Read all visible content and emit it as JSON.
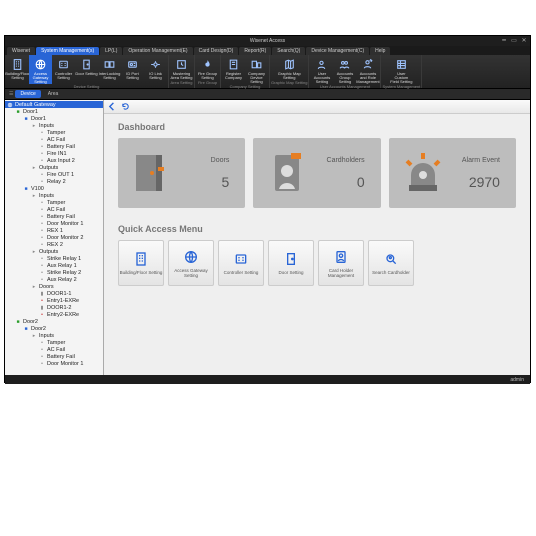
{
  "title": "Wisenet Access",
  "menu_tabs": [
    "Wisenet",
    "System Management(s)",
    "LP(L)",
    "Operation Management(E)",
    "Card Design(D)",
    "Report(R)",
    "Search(Q)",
    "Device Management(C)",
    "Help"
  ],
  "active_menu_tab": 1,
  "ribbon_groups": [
    {
      "label": "Device Setting",
      "items": [
        {
          "icon": "building",
          "label": "Building/Floor Setting"
        },
        {
          "icon": "globe",
          "label": "Access Gateway Setting",
          "active": true
        },
        {
          "icon": "controller",
          "label": "Controller Setting"
        },
        {
          "icon": "door",
          "label": "Door Setting"
        },
        {
          "icon": "interlock",
          "label": "InterLocking Setting"
        },
        {
          "icon": "idport",
          "label": "ID Port Setting"
        },
        {
          "icon": "iolink",
          "label": "IO Link Setting"
        }
      ]
    },
    {
      "label": "Area Setting",
      "items": [
        {
          "icon": "muster",
          "label": "Mustering Area Setting"
        }
      ]
    },
    {
      "label": "Fire Group",
      "items": [
        {
          "icon": "fire",
          "label": "Fire Group Setting"
        }
      ]
    },
    {
      "label": "Company Setting",
      "items": [
        {
          "icon": "register",
          "label": "Register Company"
        },
        {
          "icon": "companydev",
          "label": "Company Device Setting"
        }
      ]
    },
    {
      "label": "Graphic Map Setting",
      "items": [
        {
          "icon": "map",
          "label": "Graphic Map Setting"
        }
      ]
    },
    {
      "label": "User Accounts Management",
      "items": [
        {
          "icon": "user",
          "label": "User Accounts Setting"
        },
        {
          "icon": "group",
          "label": "Accounts Group Setting"
        },
        {
          "icon": "role",
          "label": "Accounts and Role Management"
        }
      ]
    },
    {
      "label": "System Management",
      "items": [
        {
          "icon": "field",
          "label": "User Custom Field Setting"
        }
      ]
    }
  ],
  "pane_tabs": [
    "Device",
    "Area"
  ],
  "tree": [
    {
      "d": 0,
      "i": "globe",
      "c": "root",
      "t": "Default Gateway"
    },
    {
      "d": 1,
      "i": "sq-green",
      "t": "Door1"
    },
    {
      "d": 2,
      "i": "sq-blue",
      "t": "Door1"
    },
    {
      "d": 3,
      "i": "folder",
      "t": "Inputs"
    },
    {
      "d": 4,
      "i": "dot",
      "t": "Tamper"
    },
    {
      "d": 4,
      "i": "dot",
      "t": "AC Fail"
    },
    {
      "d": 4,
      "i": "dot",
      "t": "Battery Fail"
    },
    {
      "d": 4,
      "i": "dot",
      "t": "Fire IN1"
    },
    {
      "d": 4,
      "i": "dot",
      "t": "Aux Input 2"
    },
    {
      "d": 3,
      "i": "folder",
      "t": "Outputs"
    },
    {
      "d": 4,
      "i": "dot",
      "t": "Fire OUT 1"
    },
    {
      "d": 4,
      "i": "dot",
      "t": "Relay 2"
    },
    {
      "d": 2,
      "i": "sq-blue",
      "t": "V100"
    },
    {
      "d": 3,
      "i": "folder",
      "t": "Inputs"
    },
    {
      "d": 4,
      "i": "dot",
      "t": "Tamper"
    },
    {
      "d": 4,
      "i": "dot",
      "t": "AC Fail"
    },
    {
      "d": 4,
      "i": "dot",
      "t": "Battery Fail"
    },
    {
      "d": 4,
      "i": "dot",
      "t": "Door Monitor 1"
    },
    {
      "d": 4,
      "i": "dot",
      "t": "REX 1"
    },
    {
      "d": 4,
      "i": "dot",
      "t": "Door Monitor 2"
    },
    {
      "d": 4,
      "i": "dot",
      "t": "REX 2"
    },
    {
      "d": 3,
      "i": "folder",
      "t": "Outputs"
    },
    {
      "d": 4,
      "i": "dot",
      "t": "Strike Relay 1"
    },
    {
      "d": 4,
      "i": "dot",
      "t": "Aux Relay 1"
    },
    {
      "d": 4,
      "i": "dot",
      "t": "Strike Relay 2"
    },
    {
      "d": 4,
      "i": "dot",
      "t": "Aux Relay 2"
    },
    {
      "d": 3,
      "i": "folder",
      "t": "Doors"
    },
    {
      "d": 4,
      "i": "door-g",
      "t": "DOOR1-1"
    },
    {
      "d": 4,
      "i": "dot-r",
      "t": "Entry1-EXRe"
    },
    {
      "d": 4,
      "i": "door-g",
      "t": "DOOR1-2"
    },
    {
      "d": 4,
      "i": "dot-r",
      "t": "Entry2-EXRe"
    },
    {
      "d": 1,
      "i": "sq-green",
      "t": "Door2"
    },
    {
      "d": 2,
      "i": "sq-blue",
      "t": "Door2"
    },
    {
      "d": 3,
      "i": "folder",
      "t": "Inputs"
    },
    {
      "d": 4,
      "i": "dot",
      "t": "Tamper"
    },
    {
      "d": 4,
      "i": "dot",
      "t": "AC Fail"
    },
    {
      "d": 4,
      "i": "dot",
      "t": "Battery Fail"
    },
    {
      "d": 4,
      "i": "dot",
      "t": "Door Monitor 1"
    }
  ],
  "dashboard_title": "Dashboard",
  "cards": [
    {
      "label": "Doors",
      "value": "5",
      "icon": "door"
    },
    {
      "label": "Cardholders",
      "value": "0",
      "icon": "cardholder"
    },
    {
      "label": "Alarm Event",
      "value": "2970",
      "icon": "alarm"
    }
  ],
  "quick_title": "Quick Access Menu",
  "quick": [
    {
      "label": "Building/Floor Setting",
      "icon": "building"
    },
    {
      "label": "Access Gateway Setting",
      "icon": "globe"
    },
    {
      "label": "Controller Setting",
      "icon": "controller"
    },
    {
      "label": "Door Setting",
      "icon": "door"
    },
    {
      "label": "Card Holder Management",
      "icon": "cardholder"
    },
    {
      "label": "Search Cardholder",
      "icon": "search-user"
    }
  ],
  "status_user": "admin",
  "toolbar_icons": [
    "back",
    "refresh"
  ]
}
